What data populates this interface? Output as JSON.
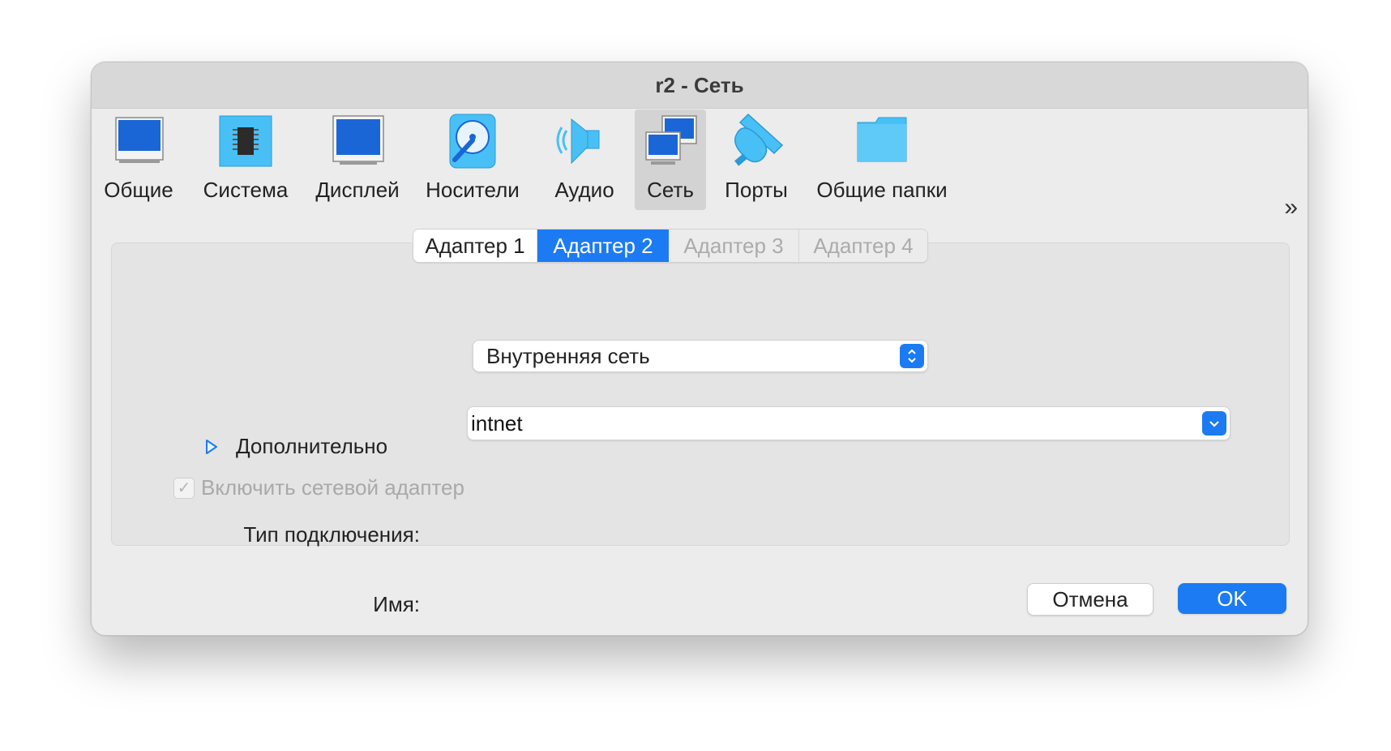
{
  "window": {
    "title": "r2 - Сеть"
  },
  "toolbar": {
    "items": [
      {
        "label": "Общие",
        "icon": "general-icon"
      },
      {
        "label": "Система",
        "icon": "chip-icon"
      },
      {
        "label": "Дисплей",
        "icon": "display-icon"
      },
      {
        "label": "Носители",
        "icon": "storage-icon"
      },
      {
        "label": "Аудио",
        "icon": "speaker-icon"
      },
      {
        "label": "Сеть",
        "icon": "network-icon",
        "selected": true
      },
      {
        "label": "Порты",
        "icon": "ports-icon"
      },
      {
        "label": "Общие папки",
        "icon": "folder-icon"
      }
    ],
    "more_glyph": "»"
  },
  "adapter_tabs": [
    {
      "label": "Адаптер 1",
      "state": "normal"
    },
    {
      "label": "Адаптер 2",
      "state": "active"
    },
    {
      "label": "Адаптер 3",
      "state": "disabled"
    },
    {
      "label": "Адаптер 4",
      "state": "disabled"
    }
  ],
  "adapter": {
    "enable_label": "Включить сетевой адаптер",
    "enabled": true,
    "attached_label": "Тип подключения:",
    "attached_value": "Внутренняя сеть",
    "name_label": "Имя:",
    "name_value": "intnet",
    "advanced_label": "Дополнительно"
  },
  "buttons": {
    "cancel": "Отмена",
    "ok": "OK"
  },
  "colors": {
    "accent": "#1c7bf2",
    "icon_blue": "#1a66d6",
    "icon_light": "#48c0f5"
  }
}
